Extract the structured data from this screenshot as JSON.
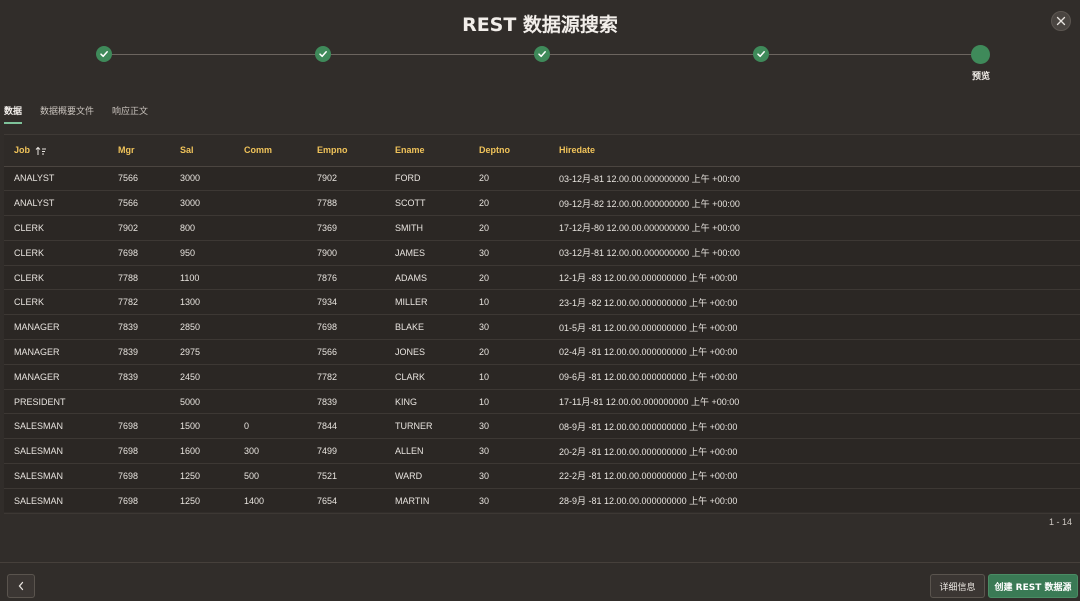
{
  "title": "REST 数据源搜索",
  "wizard": {
    "steps": [
      {
        "status": "done",
        "label": ""
      },
      {
        "status": "done",
        "label": ""
      },
      {
        "status": "done",
        "label": ""
      },
      {
        "status": "done",
        "label": ""
      },
      {
        "status": "current",
        "label": "预览"
      }
    ]
  },
  "tabs": [
    {
      "label": "数据",
      "active": true
    },
    {
      "label": "数据概要文件",
      "active": false
    },
    {
      "label": "响应正文",
      "active": false
    }
  ],
  "table": {
    "columns": [
      "Job",
      "Mgr",
      "Sal",
      "Comm",
      "Empno",
      "Ename",
      "Deptno",
      "Hiredate"
    ],
    "rows": [
      [
        "ANALYST",
        "7566",
        "3000",
        "",
        "7902",
        "FORD",
        "20",
        "03-12月-81 12.00.00.000000000 上午 +00:00"
      ],
      [
        "ANALYST",
        "7566",
        "3000",
        "",
        "7788",
        "SCOTT",
        "20",
        "09-12月-82 12.00.00.000000000 上午 +00:00"
      ],
      [
        "CLERK",
        "7902",
        "800",
        "",
        "7369",
        "SMITH",
        "20",
        "17-12月-80 12.00.00.000000000 上午 +00:00"
      ],
      [
        "CLERK",
        "7698",
        "950",
        "",
        "7900",
        "JAMES",
        "30",
        "03-12月-81 12.00.00.000000000 上午 +00:00"
      ],
      [
        "CLERK",
        "7788",
        "1100",
        "",
        "7876",
        "ADAMS",
        "20",
        "12-1月 -83 12.00.00.000000000 上午 +00:00"
      ],
      [
        "CLERK",
        "7782",
        "1300",
        "",
        "7934",
        "MILLER",
        "10",
        "23-1月 -82 12.00.00.000000000 上午 +00:00"
      ],
      [
        "MANAGER",
        "7839",
        "2850",
        "",
        "7698",
        "BLAKE",
        "30",
        "01-5月 -81 12.00.00.000000000 上午 +00:00"
      ],
      [
        "MANAGER",
        "7839",
        "2975",
        "",
        "7566",
        "JONES",
        "20",
        "02-4月 -81 12.00.00.000000000 上午 +00:00"
      ],
      [
        "MANAGER",
        "7839",
        "2450",
        "",
        "7782",
        "CLARK",
        "10",
        "09-6月 -81 12.00.00.000000000 上午 +00:00"
      ],
      [
        "PRESIDENT",
        "",
        "5000",
        "",
        "7839",
        "KING",
        "10",
        "17-11月-81 12.00.00.000000000 上午 +00:00"
      ],
      [
        "SALESMAN",
        "7698",
        "1500",
        "0",
        "7844",
        "TURNER",
        "30",
        "08-9月 -81 12.00.00.000000000 上午 +00:00"
      ],
      [
        "SALESMAN",
        "7698",
        "1600",
        "300",
        "7499",
        "ALLEN",
        "30",
        "20-2月 -81 12.00.00.000000000 上午 +00:00"
      ],
      [
        "SALESMAN",
        "7698",
        "1250",
        "500",
        "7521",
        "WARD",
        "30",
        "22-2月 -81 12.00.00.000000000 上午 +00:00"
      ],
      [
        "SALESMAN",
        "7698",
        "1250",
        "1400",
        "7654",
        "MARTIN",
        "30",
        "28-9月 -81 12.00.00.000000000 上午 +00:00"
      ]
    ],
    "sorted_column": "Job",
    "sort_icon": "sort-ascending-icon",
    "range_text": "1 - 14"
  },
  "footer": {
    "back_icon": "chevron-left-icon",
    "details_label": "详细信息",
    "create_label": "创建 REST 数据源"
  },
  "colors": {
    "background": "#312d2a",
    "header_text": "#f0c35a",
    "accent_green": "#3f8a5a",
    "primary_button": "#3a7a55"
  }
}
